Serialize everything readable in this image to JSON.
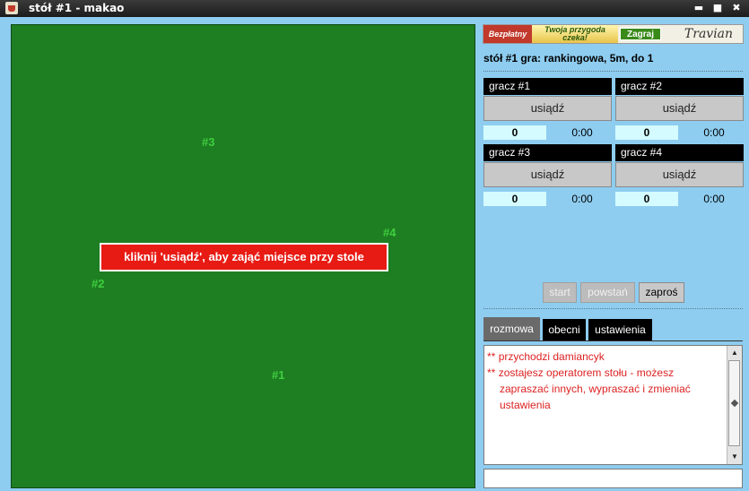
{
  "window": {
    "title": "stół #1 - makao"
  },
  "banner": {
    "left": "Bezpłatny",
    "middle": "Twoja przygoda czeka!",
    "cta": "Zagraj",
    "brand": "Travian"
  },
  "table": {
    "info": "stół #1  gra: rankingowa, 5m, do 1",
    "seats": {
      "s1": "#1",
      "s2": "#2",
      "s3": "#3",
      "s4": "#4"
    },
    "message": "kliknij 'usiądź', aby zająć miejsce przy stole"
  },
  "players": [
    {
      "name": "gracz #1",
      "sit": "usiądź",
      "score": "0",
      "time": "0:00"
    },
    {
      "name": "gracz #2",
      "sit": "usiądź",
      "score": "0",
      "time": "0:00"
    },
    {
      "name": "gracz #3",
      "sit": "usiądź",
      "score": "0",
      "time": "0:00"
    },
    {
      "name": "gracz #4",
      "sit": "usiądź",
      "score": "0",
      "time": "0:00"
    }
  ],
  "actions": {
    "start": "start",
    "stand": "powstań",
    "invite": "zaproś"
  },
  "tabs": {
    "chat": "rozmowa",
    "present": "obecni",
    "settings": "ustawienia"
  },
  "chat": {
    "lines": [
      {
        "mark": "**",
        "text": "przychodzi damiancyk"
      },
      {
        "mark": "**",
        "text": "zostajesz operatorem stołu - możesz"
      }
    ],
    "continuation": [
      "zapraszać innych, wypraszać i zmieniać",
      "ustawienia"
    ]
  },
  "colors": {
    "table": "#1e7e22",
    "message_bg": "#e81b14",
    "panel": "#8ecdf0",
    "chat_text": "#dd2222"
  }
}
